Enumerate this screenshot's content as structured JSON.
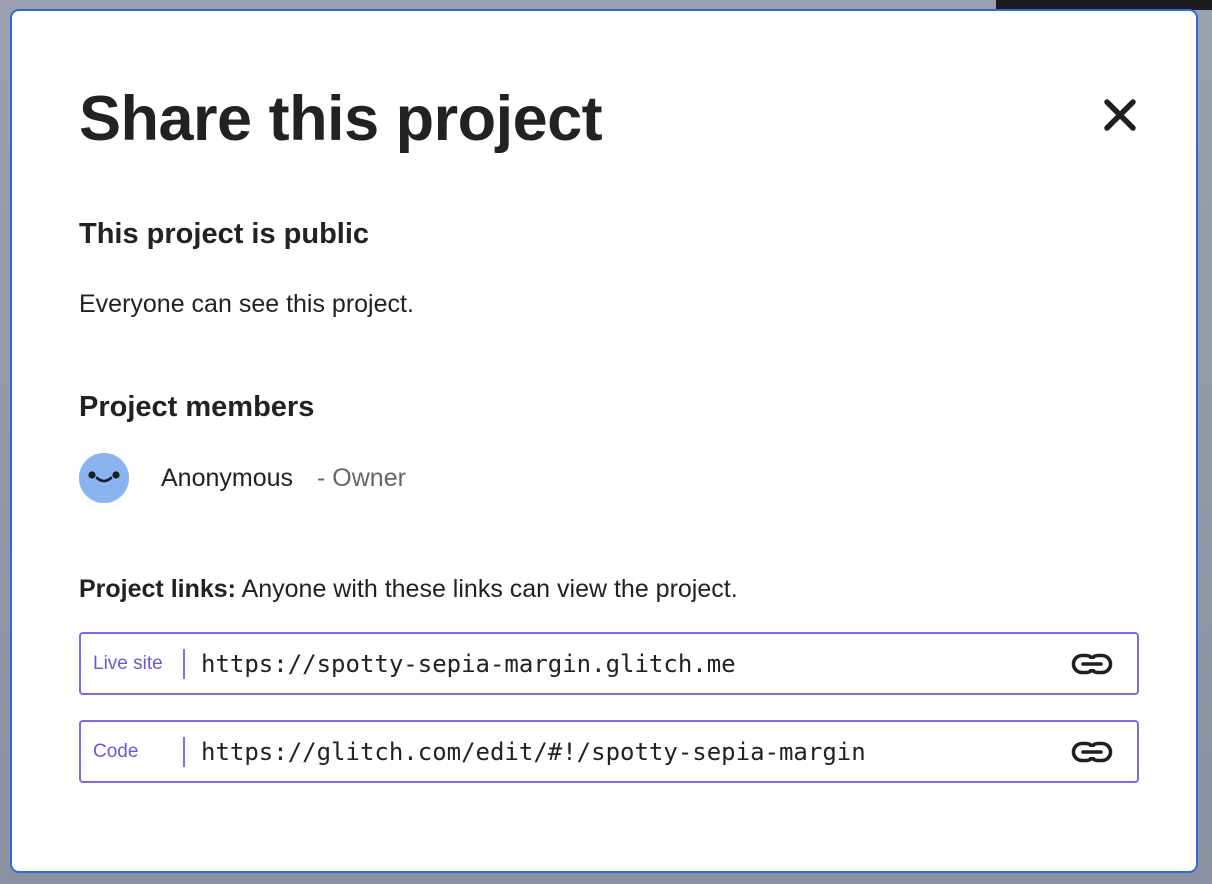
{
  "modal": {
    "title": "Share this project",
    "close_icon": "close-icon"
  },
  "visibility": {
    "heading": "This project is public",
    "description": "Everyone can see this project."
  },
  "members": {
    "heading": "Project members",
    "items": [
      {
        "name": "Anonymous",
        "role": "- Owner",
        "avatar_icon": "anonymous-avatar",
        "avatar_color": "#8ab4ee"
      }
    ]
  },
  "links": {
    "intro_bold": "Project links:",
    "intro_text": " Anyone with these links can view the project.",
    "items": [
      {
        "label": "Live site",
        "url": "https://spotty-sepia-margin.glitch.me",
        "copy_icon": "link-icon"
      },
      {
        "label": "Code",
        "url": "https://glitch.com/edit/#!/spotty-sepia-margin",
        "copy_icon": "link-icon"
      }
    ]
  },
  "colors": {
    "modal_border": "#2d6bd3",
    "field_border": "#7b6ee0",
    "label_text": "#6a5acd",
    "text": "#222222",
    "muted_text": "#666666"
  }
}
